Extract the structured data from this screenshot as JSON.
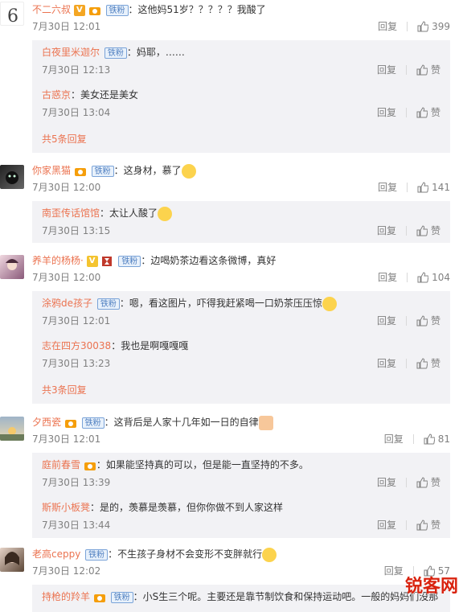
{
  "comments": [
    {
      "user": "不二六叔",
      "badge": "铁粉",
      "text": "：这他妈51岁？？？？？我酸了",
      "time": "7月30日 12:01",
      "reply_label": "回复",
      "likes": "399",
      "replies": [
        {
          "user": "白夜里米迦尔",
          "badge": "铁粉",
          "text": "：妈耶，……",
          "time": "7月30日 12:13",
          "reply_label": "回复",
          "like_label": "赞"
        },
        {
          "user": "古惑京",
          "badge": "",
          "text": "：美女还是美女",
          "time": "7月30日 13:04",
          "reply_label": "回复",
          "like_label": "赞"
        }
      ],
      "more": "共5条回复"
    },
    {
      "user": "你家黑猫",
      "badge": "铁粉",
      "text": "：这身材，慕了",
      "time": "7月30日 12:00",
      "reply_label": "回复",
      "likes": "141",
      "replies": [
        {
          "user": "南歪传话馆馆",
          "badge": "",
          "text": "：太让人酸了",
          "time": "7月30日 13:15",
          "reply_label": "回复",
          "like_label": "赞"
        }
      ],
      "more": ""
    },
    {
      "user": "养羊的杨杨·",
      "badge": "铁粉",
      "text": "：边喝奶茶边看这条微博，真好",
      "time": "7月30日 12:00",
      "reply_label": "回复",
      "likes": "104",
      "replies": [
        {
          "user": "涂鸦de孩子",
          "badge": "铁粉",
          "text": "：嗯，看这图片，吓得我赶紧喝一口奶茶压压惊",
          "time": "7月30日 12:01",
          "reply_label": "回复",
          "like_label": "赞"
        },
        {
          "user": "志在四方30038",
          "badge": "",
          "text": "：我也是啊嘎嘎嘎",
          "time": "7月30日 13:23",
          "reply_label": "回复",
          "like_label": "赞"
        }
      ],
      "more": "共3条回复"
    },
    {
      "user": "夕西瓷",
      "badge": "铁粉",
      "text": "：这背后是人家十几年如一日的自律",
      "time": "7月30日 12:01",
      "reply_label": "回复",
      "likes": "81",
      "replies": [
        {
          "user": "庭前春雪",
          "badge": "",
          "text": "：如果能坚持真的可以，但是能一直坚持的不多。",
          "time": "7月30日 13:39",
          "reply_label": "回复",
          "like_label": "赞"
        },
        {
          "user": "斯斯小板凳",
          "badge": "",
          "text": "：是的，羡慕是羡慕，但你你做不到人家这样",
          "time": "7月30日 13:44",
          "reply_label": "回复",
          "like_label": "赞"
        }
      ],
      "more": ""
    },
    {
      "user": "老高ceppy",
      "badge": "铁粉",
      "text": "：不生孩子身材不会变形不变胖就行",
      "time": "7月30日 12:02",
      "reply_label": "回复",
      "likes": "57",
      "replies": [
        {
          "user": "持枪的羚羊",
          "badge": "铁粉",
          "text": "：小S生三个呢。主要还是靠节制饮食和保持运动吧。一般的妈妈们没那",
          "time": "",
          "reply_label": "",
          "like_label": ""
        }
      ],
      "more": ""
    }
  ],
  "watermark": "锐客网"
}
